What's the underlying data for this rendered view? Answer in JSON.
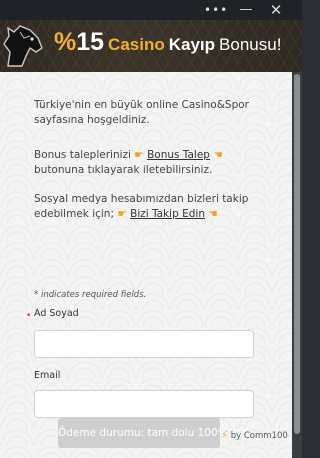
{
  "window": {
    "more_icon": "more-horizontal-icon",
    "minimize_icon": "minimize-icon",
    "close_icon": "close-icon"
  },
  "banner": {
    "percent": "%",
    "amount": "15",
    "word_casino": "Casino",
    "word_kayip": "Kayıp",
    "word_bonus": "Bonusu!",
    "logo_icon": "horse-head-logo",
    "accent_color": "#f1b035"
  },
  "intro": {
    "welcome": "Türkiye'nin en büyük online Casino&Spor sayfasına hoşgeldiniz.",
    "bonus_prefix": "Bonus taleplerinizi",
    "bonus_link": "Bonus Talep",
    "bonus_suffix": "butonuna tıklayarak iletebilirsiniz.",
    "social_prefix": "Sosyal medya hesabımızdan bizleri takip edebilmek için;",
    "social_link": "Bizi Takip Edin",
    "hand_icon": "pointing-hand-emoji"
  },
  "form": {
    "required_note": "* indicates required fields.",
    "name_label": "Ad Soyad",
    "name_value": "",
    "email_label": "Email",
    "email_value": "",
    "submit_label": "Ödeme durumu: tam dolu 100%"
  },
  "footer": {
    "powered_by": "by Comm100"
  }
}
